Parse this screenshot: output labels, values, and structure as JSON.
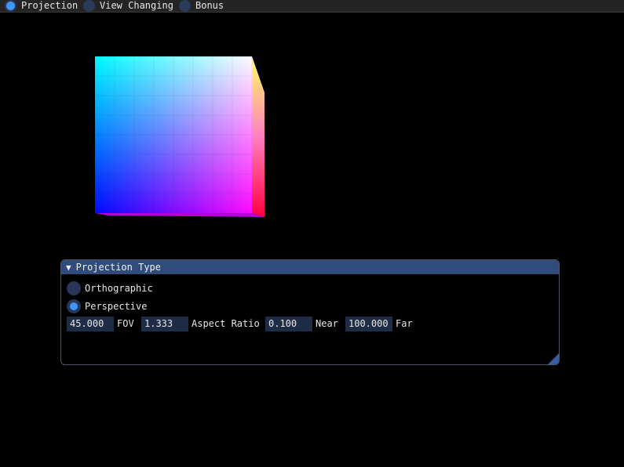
{
  "menubar": {
    "modes": [
      {
        "label": "Projection",
        "selected": true
      },
      {
        "label": "View Changing",
        "selected": false
      },
      {
        "label": "Bonus",
        "selected": false
      }
    ]
  },
  "cube": {
    "face_corner_colors": {
      "top_left": "#00ffff",
      "top_right": "#ffffff",
      "bottom_left": "#0000ff",
      "bottom_right": "#ff00ff",
      "side_top": "#ffff00",
      "side_bottom": "#ff0000"
    },
    "grid_cells": 8
  },
  "panel": {
    "title": "Projection Type",
    "options": [
      {
        "label": "Orthographic",
        "selected": false
      },
      {
        "label": "Perspective",
        "selected": true
      }
    ],
    "fields": {
      "fov": {
        "value": "45.000",
        "label": "FOV"
      },
      "aspect": {
        "value": "1.333",
        "label": "Aspect Ratio"
      },
      "near": {
        "value": "0.100",
        "label": "Near"
      },
      "far": {
        "value": "100.000",
        "label": "Far"
      }
    }
  },
  "colors": {
    "accent": "#4296fa",
    "header": "#2f4c7c",
    "field_bg": "#1f2c45",
    "radio_bg": "#283757"
  }
}
